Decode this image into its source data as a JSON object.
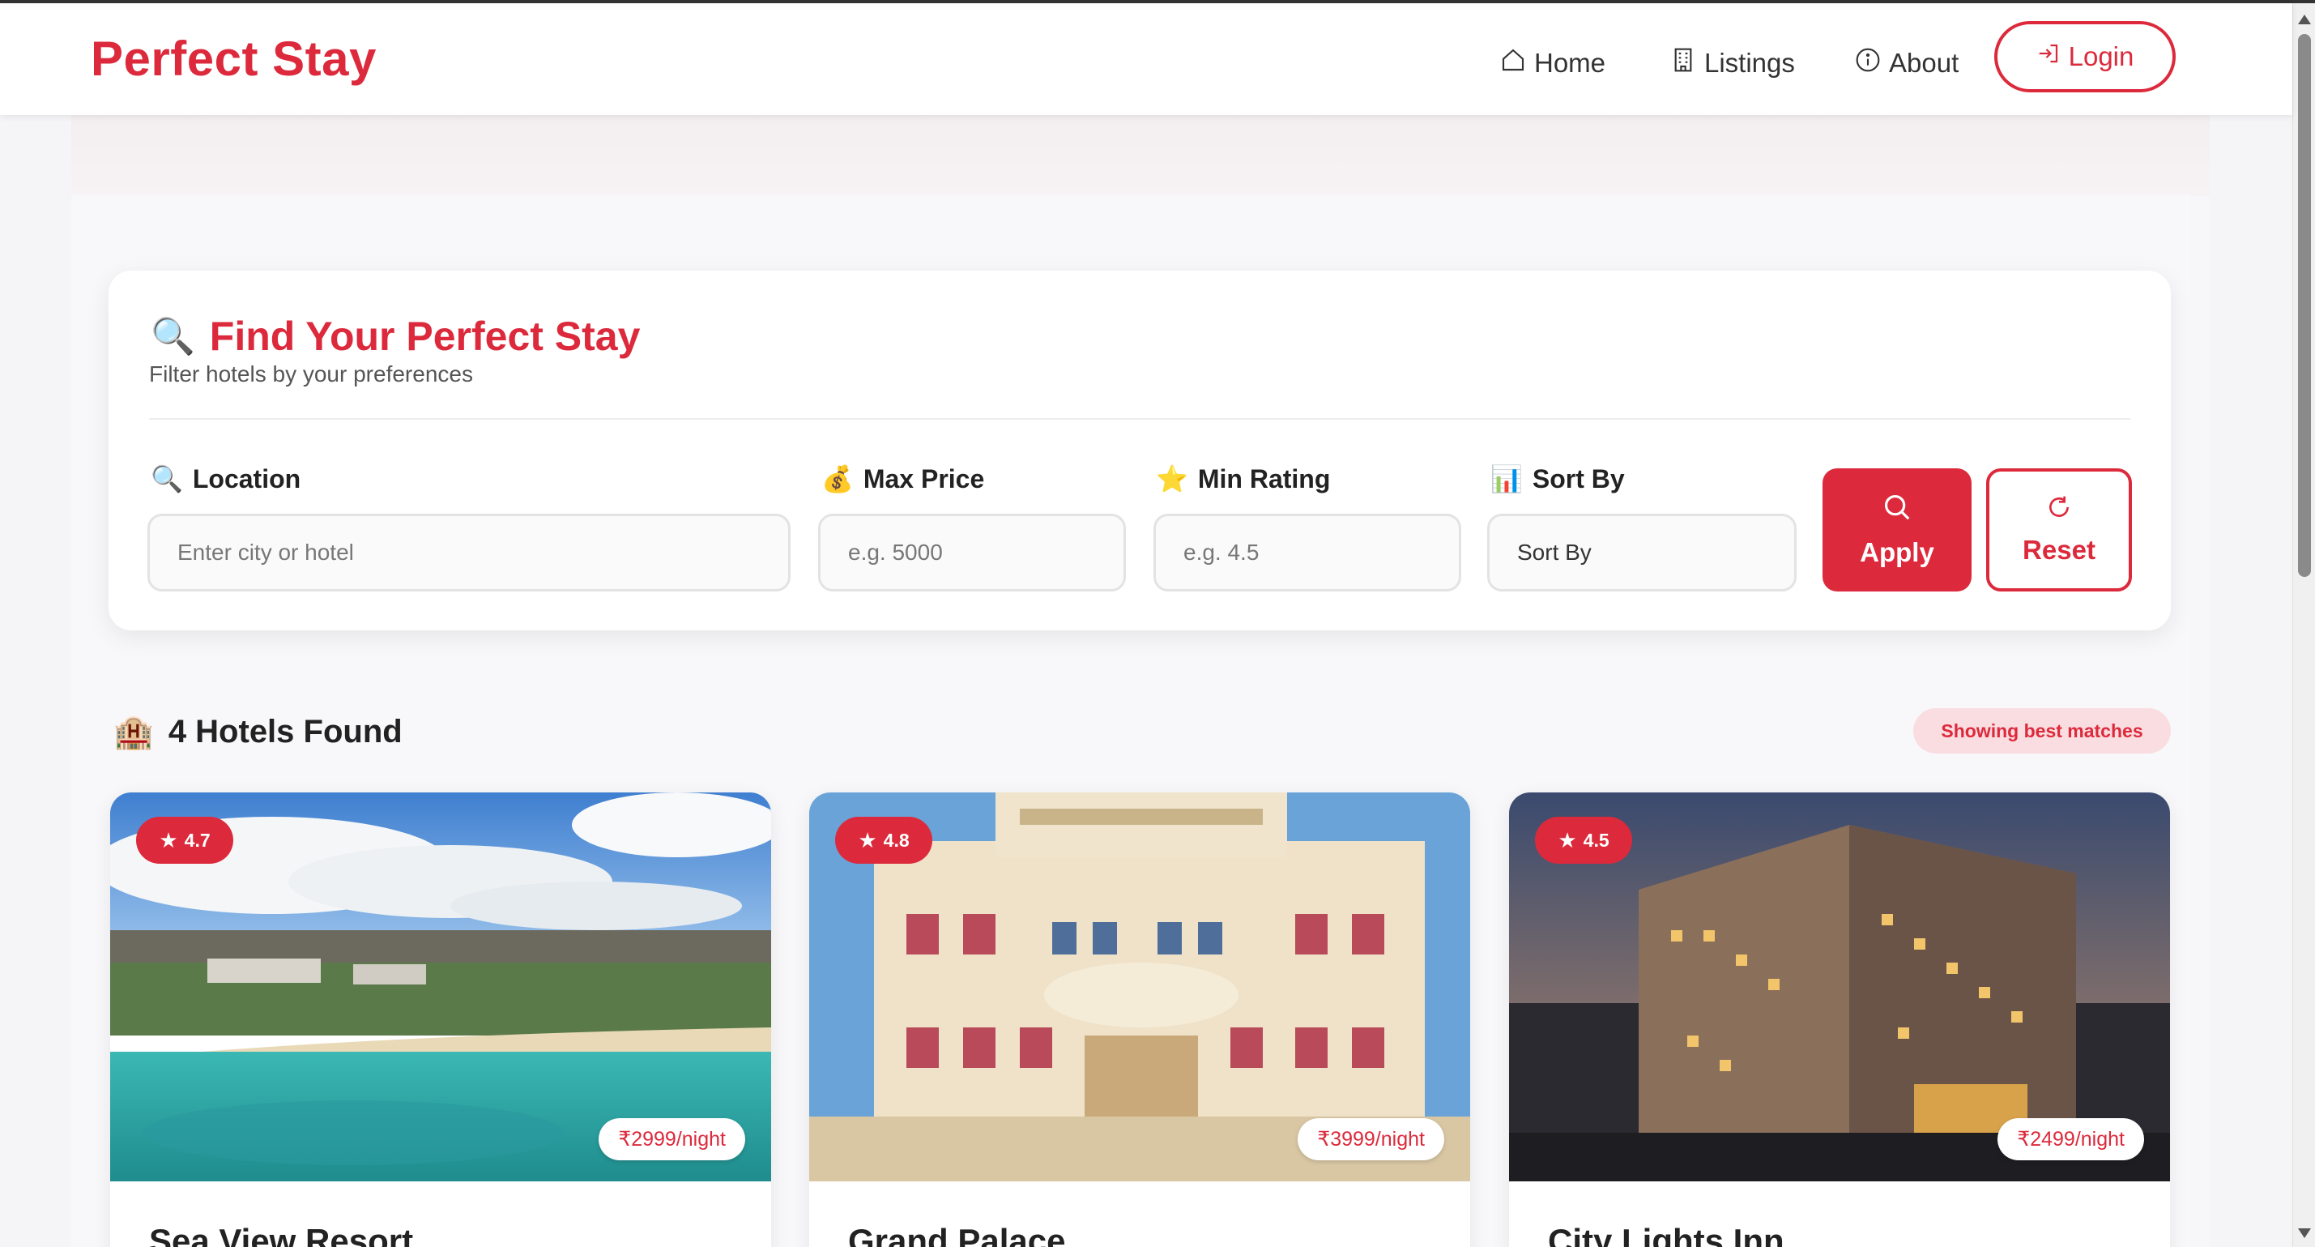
{
  "navbar": {
    "brand": "Perfect Stay",
    "items": [
      {
        "label": "Home",
        "icon": "home-icon"
      },
      {
        "label": "Listings",
        "icon": "building-icon"
      },
      {
        "label": "About",
        "icon": "info-icon"
      }
    ],
    "login_label": "Login"
  },
  "filter": {
    "title_emoji": "🔍",
    "title": "Find Your Perfect Stay",
    "subtitle": "Filter hotels by your preferences",
    "fields": {
      "location": {
        "emoji": "🔍",
        "label": "Location",
        "placeholder": "Enter city or hotel"
      },
      "max_price": {
        "emoji": "💰",
        "label": "Max Price",
        "placeholder": "e.g. 5000"
      },
      "min_rating": {
        "emoji": "⭐",
        "label": "Min Rating",
        "placeholder": "e.g. 4.5"
      },
      "sort_by": {
        "emoji": "📊",
        "label": "Sort By",
        "value": "Sort By"
      }
    },
    "apply_label": "Apply",
    "reset_label": "Reset"
  },
  "results": {
    "emoji": "🏨",
    "title": "4 Hotels Found",
    "badge": "Showing best matches"
  },
  "hotels": [
    {
      "name": "Sea View Resort",
      "rating": "4.7",
      "price": "₹2999/night"
    },
    {
      "name": "Grand Palace",
      "rating": "4.8",
      "price": "₹3999/night"
    },
    {
      "name": "City Lights Inn",
      "rating": "4.5",
      "price": "₹2499/night"
    }
  ],
  "colors": {
    "accent": "#dc2a3c",
    "badge_bg": "#fadde1"
  }
}
